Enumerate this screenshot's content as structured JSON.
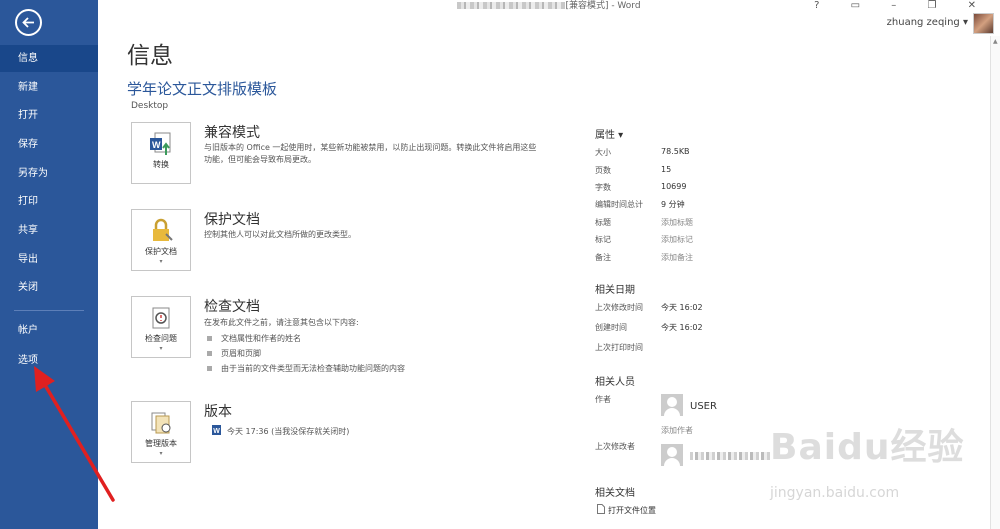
{
  "window": {
    "title_suffix": "[兼容模式] - Word",
    "controls": "? ▭ – ❐ ✕"
  },
  "account": {
    "name": "zhuang zeqing",
    "caret": "▾"
  },
  "sidebar": {
    "items": [
      {
        "label": "信息"
      },
      {
        "label": "新建"
      },
      {
        "label": "打开"
      },
      {
        "label": "保存"
      },
      {
        "label": "另存为"
      },
      {
        "label": "打印"
      },
      {
        "label": "共享"
      },
      {
        "label": "导出"
      },
      {
        "label": "关闭"
      },
      {
        "label": "帐户"
      },
      {
        "label": "选项"
      }
    ]
  },
  "page": {
    "title": "信息",
    "doc_title": "学年论文正文排版模板",
    "doc_path": "Desktop"
  },
  "sections": {
    "compat": {
      "button": "转换",
      "title": "兼容模式",
      "desc": "与旧版本的 Office 一起使用时，某些新功能被禁用，以防止出现问题。转换此文件将启用这些功能，但可能会导致布局更改。"
    },
    "protect": {
      "button": "保护文档",
      "title": "保护文档",
      "desc": "控制其他人可以对此文档所做的更改类型。"
    },
    "inspect": {
      "button": "检查问题",
      "title": "检查文档",
      "desc": "在发布此文件之前，请注意其包含以下内容:",
      "bullets": [
        "文档属性和作者的姓名",
        "页眉和页脚",
        "由于当前的文件类型而无法检查辅助功能问题的内容"
      ]
    },
    "versions": {
      "button": "管理版本",
      "title": "版本",
      "entry": "今天 17:36 (当我没保存就关闭时)"
    }
  },
  "properties": {
    "heading": "属性 ▾",
    "rows": [
      {
        "label": "大小",
        "value": "78.5KB"
      },
      {
        "label": "页数",
        "value": "15"
      },
      {
        "label": "字数",
        "value": "10699"
      },
      {
        "label": "编辑时间总计",
        "value": "9 分钟"
      },
      {
        "label": "标题",
        "value": "添加标题"
      },
      {
        "label": "标记",
        "value": "添加标记"
      },
      {
        "label": "备注",
        "value": "添加备注"
      }
    ]
  },
  "dates": {
    "heading": "相关日期",
    "rows": [
      {
        "label": "上次修改时间",
        "value": "今天 16:02"
      },
      {
        "label": "创建时间",
        "value": "今天 16:02"
      },
      {
        "label": "上次打印时间",
        "value": ""
      }
    ]
  },
  "people": {
    "heading": "相关人员",
    "author_label": "作者",
    "author_name": "USER",
    "add_author": "添加作者",
    "modifier_label": "上次修改者"
  },
  "related_docs": {
    "heading": "相关文档",
    "open_location": "打开文件位置"
  },
  "watermark": {
    "main": "Baidu经验",
    "sub": "jingyan.baidu.com"
  },
  "colors": {
    "sidebar": "#2b579a",
    "accent": "#2b579a",
    "arrow": "#e02020"
  }
}
